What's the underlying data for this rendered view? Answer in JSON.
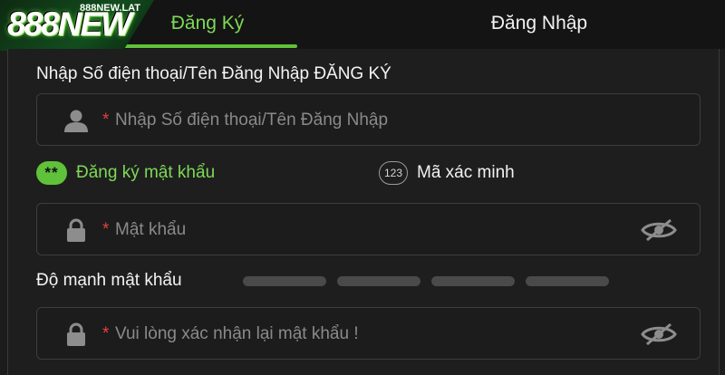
{
  "brand": {
    "logo_text": "888NEW",
    "logo_sub": "888NEW.LAT"
  },
  "tabs": [
    {
      "label": "Đăng Ký",
      "active": true
    },
    {
      "label": "Đăng Nhập",
      "active": false
    }
  ],
  "form": {
    "section_title": "Nhập Số điện thoại/Tên Đăng Nhập ĐĂNG KÝ",
    "required_mark": "*",
    "username": {
      "placeholder": "Nhập Số điện thoại/Tên Đăng Nhập",
      "value": "",
      "icon": "user-icon"
    },
    "options": [
      {
        "badge": "**",
        "label": "Đăng ký mật khẩu",
        "selected": true
      },
      {
        "badge": "123",
        "label": "Mã xác minh",
        "selected": false
      }
    ],
    "password": {
      "placeholder": "Mật khẩu",
      "value": "",
      "icon": "lock-icon"
    },
    "strength": {
      "label": "Độ mạnh mật khẩu",
      "level": 0,
      "segments": 4
    },
    "confirm_password": {
      "placeholder": "Vui lòng xác nhận lại mật khẩu !",
      "value": "",
      "icon": "lock-icon"
    }
  },
  "colors": {
    "accent": "#5fc23a",
    "accent_text": "#7ed957",
    "required": "#e0423c",
    "background": "#1c1c1c",
    "bar_inactive": "#4a4a4a"
  }
}
